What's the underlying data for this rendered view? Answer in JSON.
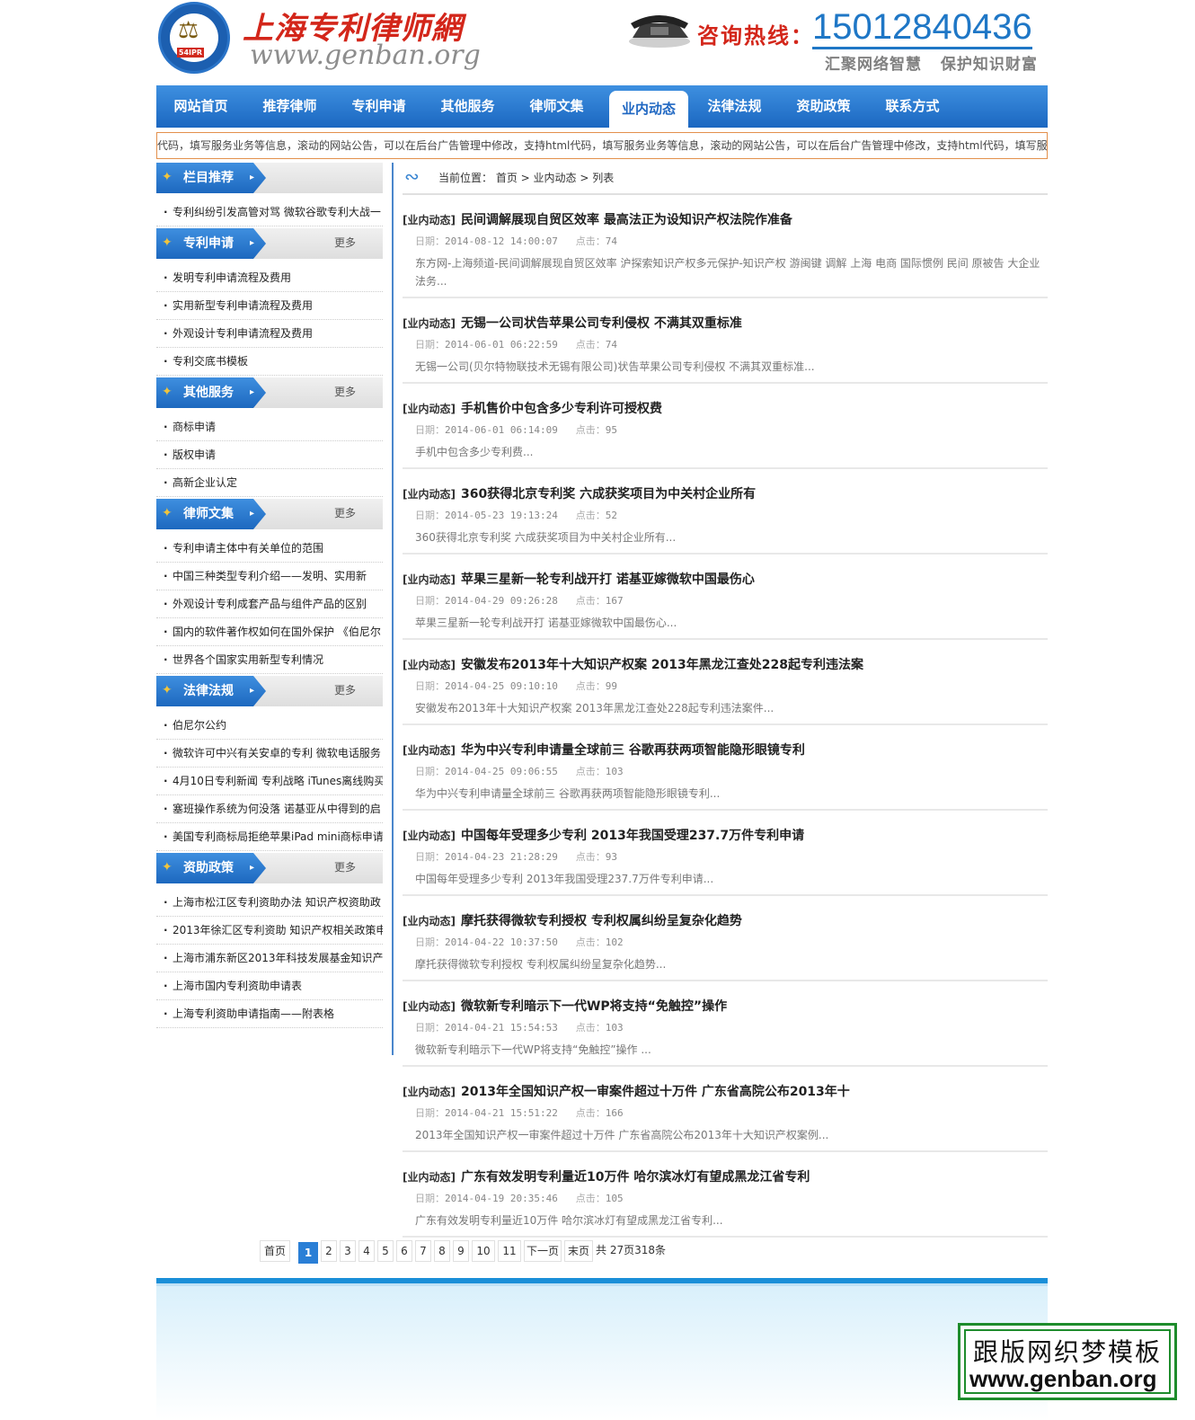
{
  "header": {
    "logo_title": "上海专利律师網",
    "logo_url": "www.genban.org",
    "logo_seal_tag": "54IPR",
    "hotline_label": "咨询热线：",
    "hotline_number": "15012840436",
    "slogan": "汇聚网络智慧 保护知识财富"
  },
  "nav": [
    {
      "label": "网站首页"
    },
    {
      "label": "推荐律师"
    },
    {
      "label": "专利申请"
    },
    {
      "label": "其他服务"
    },
    {
      "label": "律师文集"
    },
    {
      "label": "业内动态",
      "active": true
    },
    {
      "label": "法律法规"
    },
    {
      "label": "资助政策"
    },
    {
      "label": "联系方式"
    }
  ],
  "marquee": "代码，填写服务业务等信息，滚动的网站公告，可以在后台广告管理中修改，支持html代码，填写服务业务等信息，滚动的网站公告，可以在后台广告管理中修改，支持html代码，填写服务业",
  "sidebar": {
    "more_label": "更多",
    "sections": [
      {
        "title": "栏目推荐",
        "has_more": false,
        "items": [
          "专利纠纷引发高管对骂 微软谷歌专利大战一"
        ]
      },
      {
        "title": "专利申请",
        "has_more": true,
        "items": [
          "发明专利申请流程及费用",
          "实用新型专利申请流程及费用",
          "外观设计专利申请流程及费用",
          "专利交底书模板"
        ]
      },
      {
        "title": "其他服务",
        "has_more": true,
        "items": [
          "商标申请",
          "版权申请",
          "高新企业认定"
        ]
      },
      {
        "title": "律师文集",
        "has_more": true,
        "items": [
          "专利申请主体中有关单位的范围",
          "中国三种类型专利介绍——发明、实用新",
          "外观设计专利成套产品与组件产品的区别",
          "国内的软件著作权如何在国外保护 《伯尼尔",
          "世界各个国家实用新型专利情况"
        ]
      },
      {
        "title": "法律法规",
        "has_more": true,
        "items": [
          "伯尼尔公约",
          "微软许可中兴有关安卓的专利 微软电话服务",
          "4月10日专利新闻 专利战略 iTunes离线购买",
          "塞班操作系统为何没落 诺基亚从中得到的启",
          "美国专利商标局拒绝苹果iPad mini商标申请"
        ]
      },
      {
        "title": "资助政策",
        "has_more": true,
        "items": [
          "上海市松江区专利资助办法 知识产权资助政",
          "2013年徐汇区专利资助 知识产权相关政策申",
          "上海市浦东新区2013年科技发展基金知识产",
          "上海市国内专利资助申请表",
          "上海专利资助申请指南——附表格"
        ]
      }
    ]
  },
  "breadcrumb": {
    "prefix": "当前位置：",
    "path": "首页 > 业内动态 > 列表"
  },
  "labels": {
    "date": "日期：",
    "clicks": "点击："
  },
  "articles": [
    {
      "tag": "[业内动态]",
      "title": "民间调解展现自贸区效率 最高法正为设知识产权法院作准备",
      "date": "2014-08-12 14:00:07",
      "clicks": "74",
      "desc": "东方网-上海频道-民间调解展现自贸区效率 沪探索知识产权多元保护-知识产权 游闽键 调解 上海 电商 国际惯例 民间 原被告 大企业 法务..."
    },
    {
      "tag": "[业内动态]",
      "title": "无锡一公司状告苹果公司专利侵权 不满其双重标准",
      "date": "2014-06-01 06:22:59",
      "clicks": "74",
      "desc": "无锡一公司(贝尔特物联技术无锡有限公司)状告苹果公司专利侵权 不满其双重标准..."
    },
    {
      "tag": "[业内动态]",
      "title": "手机售价中包含多少专利许可授权费",
      "date": "2014-06-01 06:14:09",
      "clicks": "95",
      "desc": "手机中包含多少专利费..."
    },
    {
      "tag": "[业内动态]",
      "title": "360获得北京专利奖 六成获奖项目为中关村企业所有",
      "date": "2014-05-23 19:13:24",
      "clicks": "52",
      "desc": "360获得北京专利奖 六成获奖项目为中关村企业所有..."
    },
    {
      "tag": "[业内动态]",
      "title": "苹果三星新一轮专利战开打 诺基亚嫁微软中国最伤心",
      "date": "2014-04-29 09:26:28",
      "clicks": "167",
      "desc": "苹果三星新一轮专利战开打 诺基亚嫁微软中国最伤心..."
    },
    {
      "tag": "[业内动态]",
      "title": "安徽发布2013年十大知识产权案 2013年黑龙江查处228起专利违法案",
      "date": "2014-04-25 09:10:10",
      "clicks": "99",
      "desc": "安徽发布2013年十大知识产权案 2013年黑龙江查处228起专利违法案件..."
    },
    {
      "tag": "[业内动态]",
      "title": "华为中兴专利申请量全球前三 谷歌再获两项智能隐形眼镜专利",
      "date": "2014-04-25 09:06:55",
      "clicks": "103",
      "desc": "华为中兴专利申请量全球前三 谷歌再获两项智能隐形眼镜专利..."
    },
    {
      "tag": "[业内动态]",
      "title": "中国每年受理多少专利 2013年我国受理237.7万件专利申请",
      "date": "2014-04-23 21:28:29",
      "clicks": "93",
      "desc": "中国每年受理多少专利 2013年我国受理237.7万件专利申请..."
    },
    {
      "tag": "[业内动态]",
      "title": "摩托获得微软专利授权 专利权属纠纷呈复杂化趋势",
      "date": "2014-04-22 10:37:50",
      "clicks": "102",
      "desc": "摩托获得微软专利授权 专利权属纠纷呈复杂化趋势..."
    },
    {
      "tag": "[业内动态]",
      "title": "微软新专利暗示下一代WP将支持“免触控”操作",
      "date": "2014-04-21 15:54:53",
      "clicks": "103",
      "desc": "微软新专利暗示下一代WP将支持“免触控”操作 ..."
    },
    {
      "tag": "[业内动态]",
      "title": "2013年全国知识产权一审案件超过十万件 广东省高院公布2013年十",
      "date": "2014-04-21 15:51:22",
      "clicks": "166",
      "desc": "2013年全国知识产权一审案件超过十万件 广东省高院公布2013年十大知识产权案例..."
    },
    {
      "tag": "[业内动态]",
      "title": "广东有效发明专利量近10万件 哈尔滨冰灯有望成黑龙江省专利",
      "date": "2014-04-19 20:35:46",
      "clicks": "105",
      "desc": "广东有效发明专利量近10万件 哈尔滨冰灯有望成黑龙江省专利..."
    }
  ],
  "pager": {
    "first": "首页",
    "pages": [
      "1",
      "2",
      "3",
      "4",
      "5",
      "6",
      "7",
      "8",
      "9",
      "10",
      "11"
    ],
    "current": "1",
    "next": "下一页",
    "last": "末页",
    "total": "共 27页318条"
  },
  "watermark": {
    "line1": "跟版网织梦模板",
    "line2": "www.genban.org"
  },
  "colors": {
    "nav_blue": "#1f6fc8",
    "brand_red": "#d3261a",
    "hotline_blue": "#1f77c6",
    "watermark_green": "#1e8c2c"
  }
}
